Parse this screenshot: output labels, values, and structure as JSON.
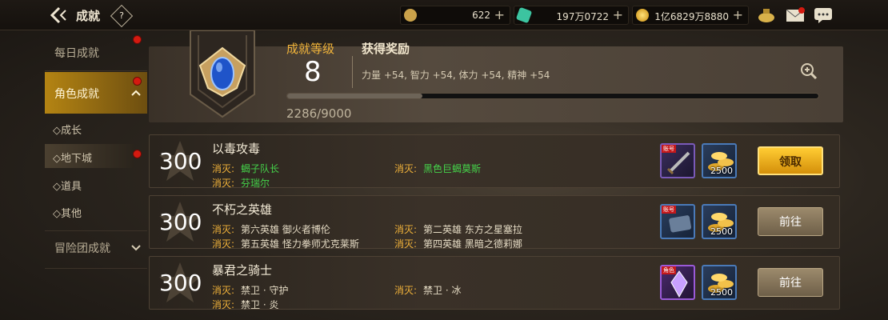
{
  "header": {
    "title": "成就",
    "help_label": "?",
    "currencies": [
      {
        "icon": "coin-c-icon",
        "value": "622"
      },
      {
        "icon": "green-gem-icon",
        "value": "197万0722"
      },
      {
        "icon": "gold-coin-icon",
        "value": "1亿6829万8880"
      }
    ],
    "plus_label": "+"
  },
  "sidebar": {
    "items": [
      {
        "label": "每日成就"
      },
      {
        "label": "角色成就"
      },
      {
        "label": "冒险团成就"
      }
    ],
    "subitems": [
      {
        "label": "◇成长"
      },
      {
        "label": "◇地下城"
      },
      {
        "label": "◇道具"
      },
      {
        "label": "◇其他"
      }
    ]
  },
  "summary": {
    "level_label": "成就等级",
    "level_value": "8",
    "reward_label": "获得奖励",
    "reward_text": "力量 +54, 智力 +54, 体力 +54, 精神 +54",
    "progress_text": "2286/9000",
    "progress_fraction": 0.254
  },
  "achievements": [
    {
      "points": "300",
      "title": "以毒攻毒",
      "tasks": [
        {
          "key": "消灭:",
          "target": "蝎子队长",
          "done": true
        },
        {
          "key": "消灭:",
          "target": "黑色巨蝎莫斯",
          "done": true
        },
        {
          "key": "消灭:",
          "target": "芬瑞尔",
          "done": true
        }
      ],
      "items": [
        {
          "tag": "账号",
          "count": ""
        },
        {
          "tag": "",
          "count": "2500"
        }
      ],
      "button": "领取"
    },
    {
      "points": "300",
      "title": "不朽之英雄",
      "tasks": [
        {
          "key": "消灭:",
          "target": "第六英雄 御火者博伦",
          "done": false
        },
        {
          "key": "消灭:",
          "target": "第二英雄 东方之星塞拉",
          "done": false
        },
        {
          "key": "消灭:",
          "target": "第五英雄 怪力拳师尤克莱斯",
          "done": false
        },
        {
          "key": "消灭:",
          "target": "第四英雄 黑暗之德莉娜",
          "done": false
        }
      ],
      "items": [
        {
          "tag": "账号",
          "count": ""
        },
        {
          "tag": "",
          "count": "2500"
        }
      ],
      "button": "前往"
    },
    {
      "points": "300",
      "title": "暴君之骑士",
      "tasks": [
        {
          "key": "消灭:",
          "target": "禁卫 · 守护",
          "done": false
        },
        {
          "key": "消灭:",
          "target": "禁卫 · 冰",
          "done": false
        },
        {
          "key": "消灭:",
          "target": "禁卫 · 炎",
          "done": false
        }
      ],
      "items": [
        {
          "tag": "角色",
          "count": ""
        },
        {
          "tag": "",
          "count": "2500"
        }
      ],
      "button": "前往"
    }
  ]
}
